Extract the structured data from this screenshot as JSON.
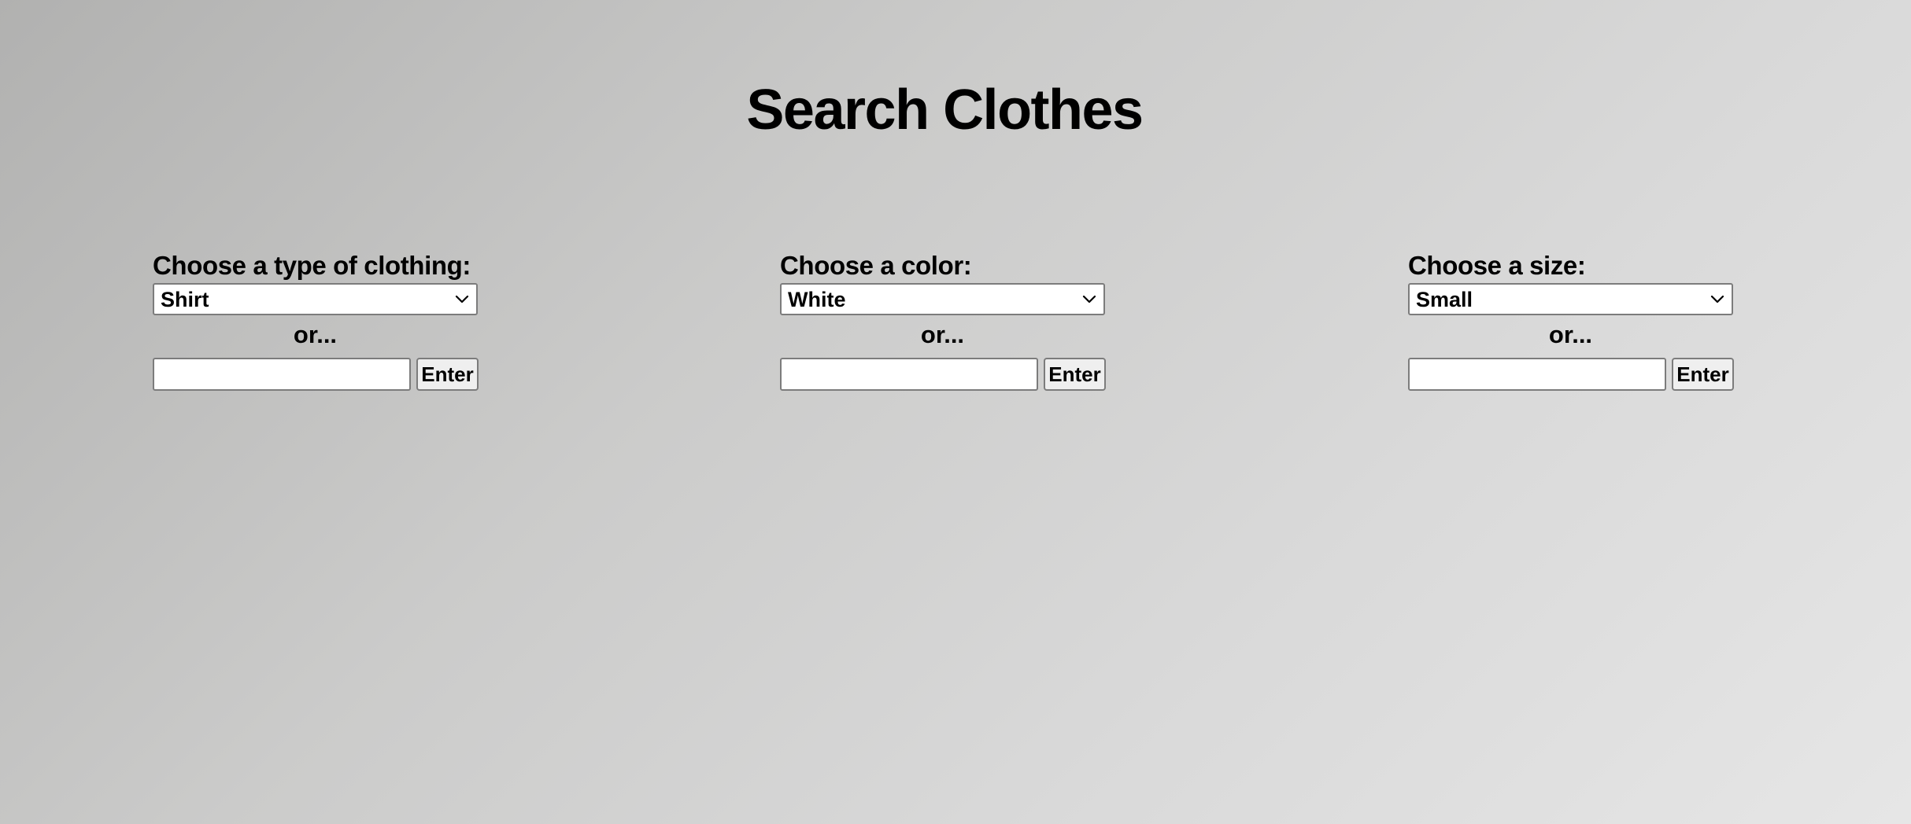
{
  "page": {
    "title": "Search Clothes"
  },
  "filters": [
    {
      "label": "Choose a type of clothing:",
      "selected": "Shirt",
      "or_text": "or...",
      "input_value": "",
      "button_label": "Enter"
    },
    {
      "label": "Choose a color:",
      "selected": "White",
      "or_text": "or...",
      "input_value": "",
      "button_label": "Enter"
    },
    {
      "label": "Choose a size:",
      "selected": "Small",
      "or_text": "or...",
      "input_value": "",
      "button_label": "Enter"
    }
  ],
  "icons": {
    "dropdown": "chevron-down-icon"
  },
  "colors": {
    "background_start": "#b1b1b0",
    "background_end": "#e6e6e6",
    "control_border": "#7c7c7c",
    "button_background": "#efefef"
  }
}
